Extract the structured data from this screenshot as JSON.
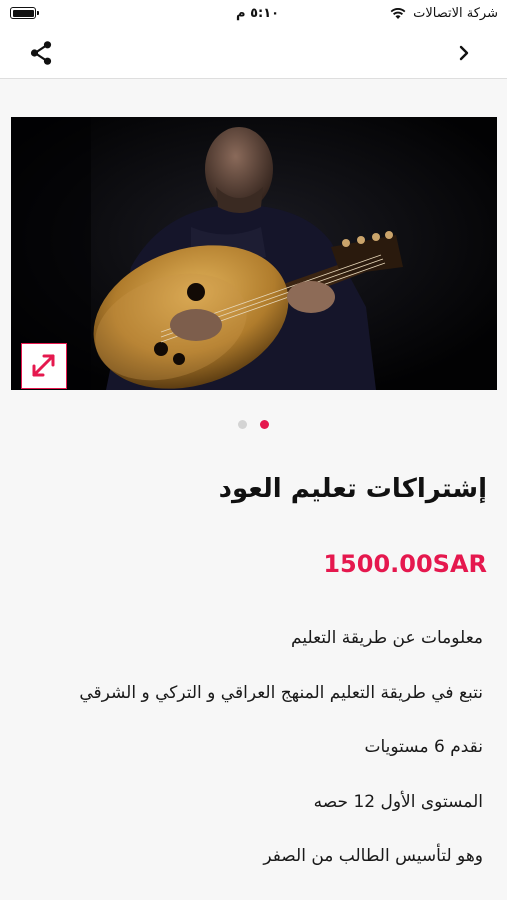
{
  "status_bar": {
    "carrier": "شركة الاتصالات",
    "time": "٥:١٠ م",
    "battery_level": 1.0
  },
  "nav": {
    "back_icon": "chevron-right-icon",
    "share_icon": "share-icon"
  },
  "carousel": {
    "image": "oud-player-photo",
    "expand_icon": "expand-icon",
    "page_count": 2,
    "active_page": 2
  },
  "product": {
    "title": "إشتراكات تعليم العود",
    "price": "1500.00SAR",
    "description": [
      "معلومات عن طريقة التعليم",
      "نتبع في طريقة التعليم المنهج العراقي و التركي و الشرقي",
      "نقدم 6 مستويات",
      "المستوى الأول 12 حصه",
      "وهو لتأسيس الطالب من الصفر"
    ]
  },
  "colors": {
    "accent": "#e5184e",
    "background": "#f7f7f7",
    "text": "#111111"
  }
}
